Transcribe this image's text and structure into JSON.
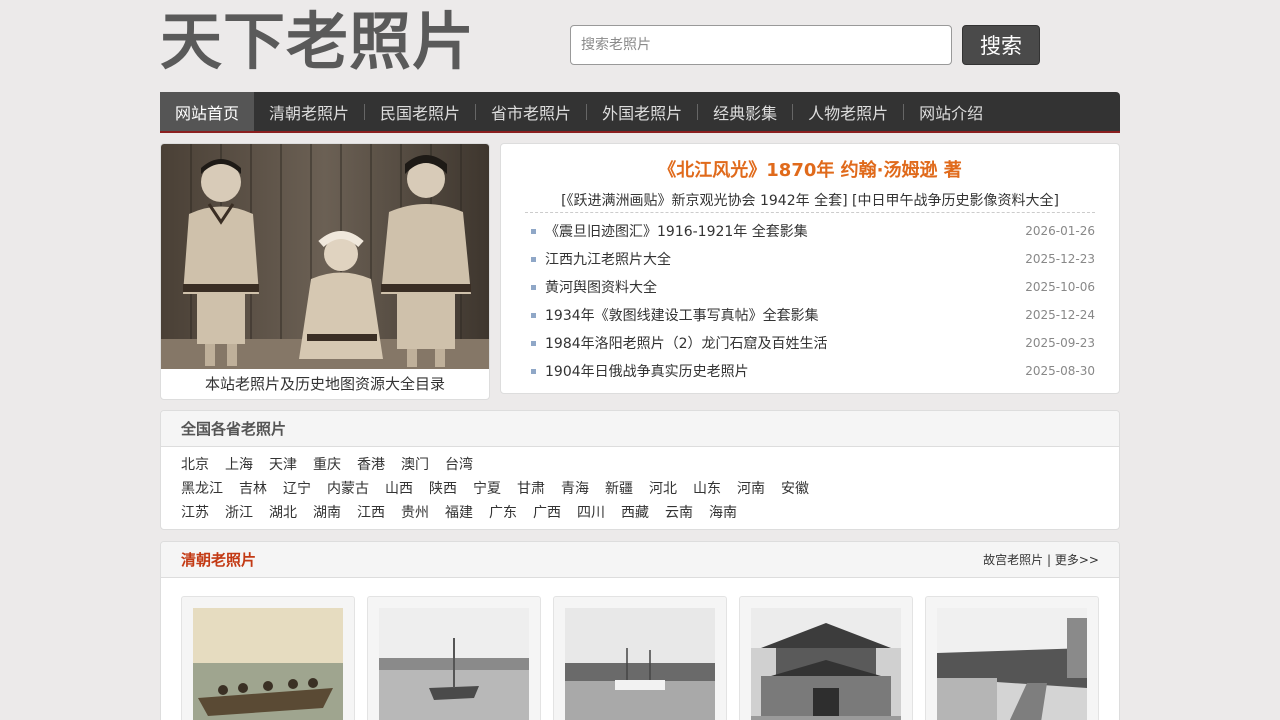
{
  "site": {
    "logo": "天下老照片"
  },
  "search": {
    "placeholder": "搜索老照片",
    "button": "搜索"
  },
  "nav": {
    "items": [
      {
        "label": "网站首页",
        "active": true
      },
      {
        "label": "清朝老照片"
      },
      {
        "label": "民国老照片"
      },
      {
        "label": "省市老照片"
      },
      {
        "label": "外国老照片"
      },
      {
        "label": "经典影集"
      },
      {
        "label": "人物老照片"
      },
      {
        "label": "网站介绍"
      }
    ]
  },
  "feature": {
    "caption": "本站老照片及历史地图资源大全目录"
  },
  "news": {
    "headline": "《北江风光》1870年 约翰·汤姆逊 著",
    "subline": "[《跃进满洲画贴》新京观光协会 1942年 全套] [中日甲午战争历史影像资料大全]",
    "items": [
      {
        "title": "《震旦旧迹图汇》1916-1921年 全套影集",
        "date": "2026-01-26"
      },
      {
        "title": "江西九江老照片大全",
        "date": "2025-12-23"
      },
      {
        "title": "黄河舆图资料大全",
        "date": "2025-10-06"
      },
      {
        "title": "1934年《敦图线建设工事写真帖》全套影集",
        "date": "2025-12-24"
      },
      {
        "title": "1984年洛阳老照片（2）龙门石窟及百姓生活",
        "date": "2025-09-23"
      },
      {
        "title": "1904年日俄战争真实历史老照片",
        "date": "2025-08-30"
      }
    ]
  },
  "provinces": {
    "title": "全国各省老照片",
    "rows": [
      [
        "北京",
        "上海",
        "天津",
        "重庆",
        "香港",
        "澳门",
        "台湾"
      ],
      [
        "黑龙江",
        "吉林",
        "辽宁",
        "内蒙古",
        "山西",
        "陕西",
        "宁夏",
        "甘肃",
        "青海",
        "新疆",
        "河北",
        "山东",
        "河南",
        "安徽"
      ],
      [
        "江苏",
        "浙江",
        "湖北",
        "湖南",
        "江西",
        "贵州",
        "福建",
        "广东",
        "广西",
        "四川",
        "西藏",
        "云南",
        "海南"
      ]
    ]
  },
  "qing": {
    "title": "清朝老照片",
    "link1": "故宫老照片",
    "sep": "|",
    "more": "更多>>"
  },
  "colors": {
    "nav_bg": "#333333",
    "nav_accent": "#8b1f1f",
    "headline": "#e06a1b",
    "section_title": "#c33a14"
  }
}
